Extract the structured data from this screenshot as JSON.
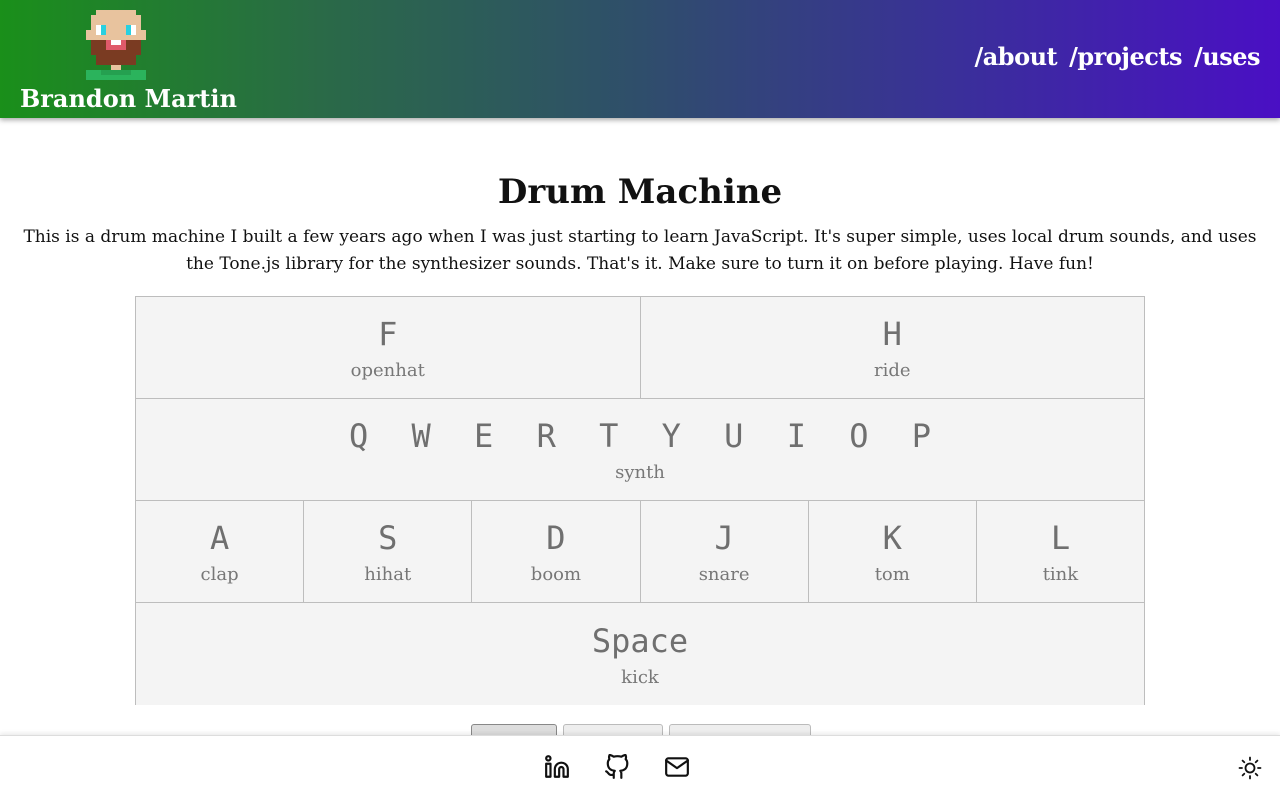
{
  "header": {
    "brand_name": "Brandon Martin",
    "nav": [
      {
        "label": "/about"
      },
      {
        "label": "/projects"
      },
      {
        "label": "/uses"
      }
    ]
  },
  "main": {
    "title": "Drum Machine",
    "intro": "This is a drum machine I built a few years ago when I was just starting to learn JavaScript. It's super simple, uses local drum sounds, and uses the Tone.js library for the synthesizer sounds. That's it. Make sure to turn it on before playing. Have fun!",
    "rows": [
      [
        {
          "key": "F",
          "sound": "openhat"
        },
        {
          "key": "H",
          "sound": "ride"
        }
      ],
      [
        {
          "key": "Q W E R T Y U I O P",
          "sound": "synth"
        }
      ],
      [
        {
          "key": "A",
          "sound": "clap"
        },
        {
          "key": "S",
          "sound": "hihat"
        },
        {
          "key": "D",
          "sound": "boom"
        },
        {
          "key": "J",
          "sound": "snare"
        },
        {
          "key": "K",
          "sound": "tom"
        },
        {
          "key": "L",
          "sound": "tink"
        }
      ],
      [
        {
          "key": "Space",
          "sound": "kick"
        }
      ]
    ]
  },
  "footer": {
    "icons": [
      "linkedin-icon",
      "github-icon",
      "mail-icon"
    ],
    "theme_icon": "sun-icon"
  }
}
